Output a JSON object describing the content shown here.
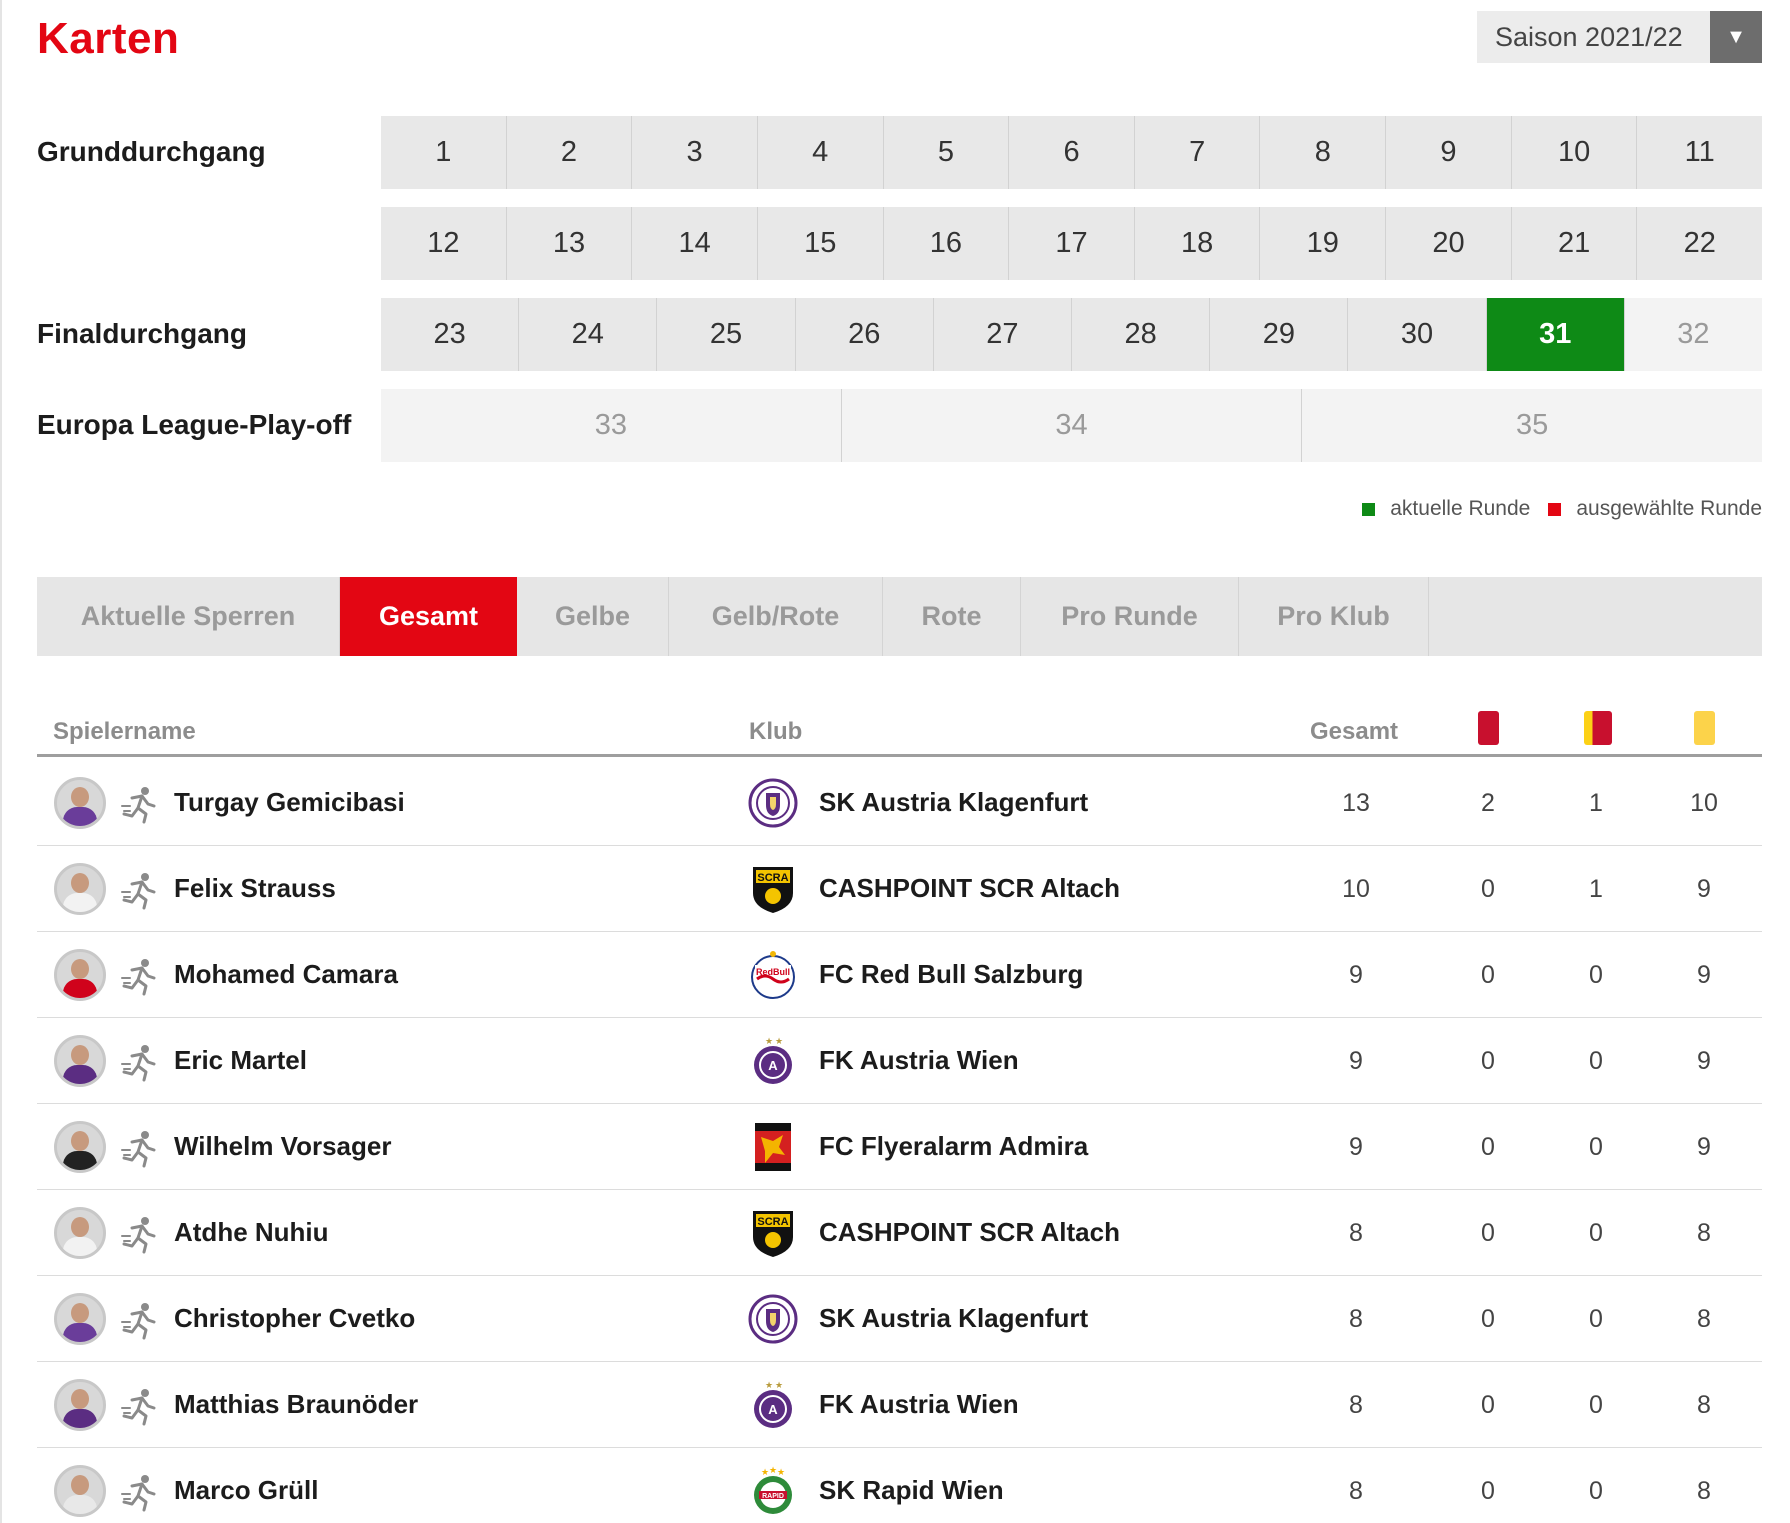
{
  "page": {
    "title": "Karten",
    "season": "Saison 2021/22"
  },
  "rounds": {
    "grund_label": "Grunddurchgang",
    "final_label": "Finaldurchgang",
    "europa_label": "Europa League-Play-off",
    "grund_row1": [
      "1",
      "2",
      "3",
      "4",
      "5",
      "6",
      "7",
      "8",
      "9",
      "10",
      "11"
    ],
    "grund_row2": [
      "12",
      "13",
      "14",
      "15",
      "16",
      "17",
      "18",
      "19",
      "20",
      "21",
      "22"
    ],
    "final": [
      "23",
      "24",
      "25",
      "26",
      "27",
      "28",
      "29",
      "30",
      "31",
      "32"
    ],
    "europa": [
      "33",
      "34",
      "35"
    ],
    "current_round": "31",
    "played_up_to": 31
  },
  "legend": {
    "current": "aktuelle Runde",
    "selected": "ausgewählte Runde",
    "current_color": "#0e8a16",
    "selected_color": "#e30613"
  },
  "tabs": [
    "Aktuelle Sperren",
    "Gesamt",
    "Gelbe",
    "Gelb/Rote",
    "Rote",
    "Pro Runde",
    "Pro Klub"
  ],
  "active_tab": "Gesamt",
  "table": {
    "headers": {
      "player": "Spielername",
      "club": "Klub",
      "total": "Gesamt"
    },
    "card_icons": [
      "red-card-icon",
      "yellow-red-card-icon",
      "yellow-card-icon"
    ],
    "rows": [
      {
        "player": "Turgay Gemicibasi",
        "club": "SK Austria Klagenfurt",
        "club_logo": "austria-klagenfurt-logo",
        "total": "13",
        "red": "2",
        "yellow_red": "1",
        "yellow": "10"
      },
      {
        "player": "Felix Strauss",
        "club": "CASHPOINT SCR Altach",
        "club_logo": "scr-altach-logo",
        "total": "10",
        "red": "0",
        "yellow_red": "1",
        "yellow": "9"
      },
      {
        "player": "Mohamed Camara",
        "club": "FC Red Bull Salzburg",
        "club_logo": "red-bull-salzburg-logo",
        "total": "9",
        "red": "0",
        "yellow_red": "0",
        "yellow": "9"
      },
      {
        "player": "Eric Martel",
        "club": "FK Austria Wien",
        "club_logo": "austria-wien-logo",
        "total": "9",
        "red": "0",
        "yellow_red": "0",
        "yellow": "9"
      },
      {
        "player": "Wilhelm Vorsager",
        "club": "FC Flyeralarm Admira",
        "club_logo": "admira-logo",
        "total": "9",
        "red": "0",
        "yellow_red": "0",
        "yellow": "9"
      },
      {
        "player": "Atdhe Nuhiu",
        "club": "CASHPOINT SCR Altach",
        "club_logo": "scr-altach-logo",
        "total": "8",
        "red": "0",
        "yellow_red": "0",
        "yellow": "8"
      },
      {
        "player": "Christopher Cvetko",
        "club": "SK Austria Klagenfurt",
        "club_logo": "austria-klagenfurt-logo",
        "total": "8",
        "red": "0",
        "yellow_red": "0",
        "yellow": "8"
      },
      {
        "player": "Matthias Braunöder",
        "club": "FK Austria Wien",
        "club_logo": "austria-wien-logo",
        "total": "8",
        "red": "0",
        "yellow_red": "0",
        "yellow": "8"
      },
      {
        "player": "Marco Grüll",
        "club": "SK Rapid Wien",
        "club_logo": "rapid-wien-logo",
        "total": "8",
        "red": "0",
        "yellow_red": "0",
        "yellow": "8"
      }
    ]
  }
}
